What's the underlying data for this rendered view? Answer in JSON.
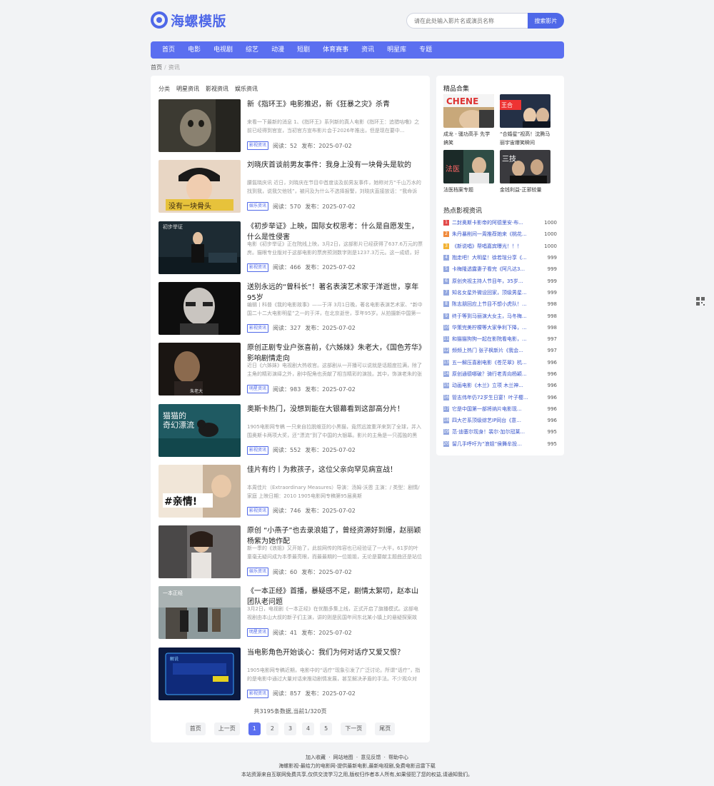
{
  "brand": {
    "name": "海螺模版",
    "accent": "#4f68e8"
  },
  "search": {
    "placeholder": "请在此处输入影片名或演员名称",
    "button": "搜索影片"
  },
  "nav": [
    "首页",
    "电影",
    "电视剧",
    "综艺",
    "动漫",
    "短剧",
    "体育赛事",
    "资讯",
    "明星库",
    "专题"
  ],
  "breadcrumb": {
    "home": "首页",
    "current": "资讯"
  },
  "categories": {
    "label": "分类",
    "items": [
      "明星资讯",
      "影视资讯",
      "娱乐资讯"
    ]
  },
  "articles": [
    {
      "title": "新《指环王》电影推迟，新《狂暴之灾》杀青",
      "desc": "来看一下最新的消息 1、《指环王》系列新的真人电影《指环王：追猎咕噜》之前已经得到官宣，当初官方宣布影片会于2026年推出，但是现在要中...",
      "tag": "影视资讯",
      "reads": "阅读：52",
      "date": "发布：2025-07-02",
      "thumb": "dark-creature"
    },
    {
      "title": "刘晓庆首谈前男友事件：我身上没有一块骨头是软的",
      "desc": "腰氤晓庆讯 近日，刘晓庆在节目中首度谈及前男友事件，她称对方“千山万水的找到我，说我欠他钱”，被问及为什么不选择报警，刘晓庆直接放话：“我命诉",
      "tag": "娱乐资讯",
      "reads": "阅读：570",
      "date": "发布：2025-07-02",
      "thumb": "woman-hat"
    },
    {
      "title": "《初步举证》上映，国际女权思考：什么是自愿发生，什么是性侵害",
      "desc": "电影《初步举证》正在院线上映，3月2日，这部影片已经获得了637.6万元的票房。猫眼专业版对于这部电影的票房预测数字则是1237.3万元。这一成绩，好像",
      "tag": "影视资讯",
      "reads": "阅读：466",
      "date": "发布：2025-07-02",
      "thumb": "stage-woman"
    },
    {
      "title": "送别永远的“曾科长”！著名表演艺术家于洋逝世，享年95岁",
      "desc": "编辑丨科普《我的电影故事》——于洋 3月1日晚，著名电影表演艺术家、“新中国二十二大电影明星”之一的于洋，在北京逝世，享年95岁。从拍摄新中国第一",
      "tag": "影视资讯",
      "reads": "阅读：327",
      "date": "发布：2025-07-02",
      "thumb": "old-man"
    },
    {
      "title": "原创正剧专业户张喜前，《六姊妹》朱老大，《国色芳华》影响剧情走向",
      "desc": "近日《六姊妹》电视剧大热收官。这部剧从一开播可以说就是话题度拉满，除了主角的精彩演绎之外，剧中配角也贡献了相当精彩的演技。其中，饰演老朱的张",
      "tag": "明星资讯",
      "reads": "阅读：983",
      "date": "发布：2025-07-02",
      "thumb": "man-dark"
    },
    {
      "title": "奥斯卡热门，没想到能在大银幕看到这部高分片！",
      "desc": "1905电影网专稿 一只来自拉脱维亚的小黑猫，竟然远渡重洋来到了全球，并入围奥斯卡两项大奖，还“漂流”到了中国的大银幕。影片的主角是一只孤独的黑",
      "tag": "影视资讯",
      "reads": "阅读：552",
      "date": "发布：2025-07-02",
      "thumb": "cat-poster"
    },
    {
      "title": "佳片有约丨为救孩子，这位父亲向罕见病宣战！",
      "desc": "本周佳片（Extraordinary Measures）导演：汤姆·沃恩 主演：/ 类型：剧情/家庭 上映日期：2010 1905电影网专稿第95届奥斯",
      "tag": "影视资讯",
      "reads": "阅读：746",
      "date": "发布：2025-07-02",
      "thumb": "family"
    },
    {
      "title": "原创 “小燕子”也去录浪姐了，曾经资源好到爆，赵丽颖杨紫为她作配",
      "desc": "新一季的《浪姐》又开始了，此前网传的阵容也已经验证了一大半，61岁的叶童毫无疑问成为本季最亮眼，而最最期的一位姐姐，无论是要献主题曲还是站位安",
      "tag": "娱乐资讯",
      "reads": "阅读：60",
      "date": "发布：2025-07-02",
      "thumb": "woman-street"
    },
    {
      "title": "《一本正经》首播，暴疑感不足，剧情太絮叨，赵本山团队老问题",
      "desc": "3月2日，电视剧《一本正经》在优酷多集上线，正式开启了旗播模式。这部电视剧由本山大叔的新子们主演，讲的则是民国年间东北某小镇上的悬疑探案故事。",
      "tag": "明星资讯",
      "reads": "阅读：41",
      "date": "发布：2025-07-02",
      "thumb": "village"
    },
    {
      "title": "当电影角色开始谈心：我们为何对话疗又爱又恨？",
      "desc": "1905电影网专稿近期，电影中的“话疗”现象引发了广泛讨论。所谓“话疗”，指的是电影中通过大量对话来推动剧情发展，甚至解决矛盾的手法。不少观众对",
      "tag": "影视资讯",
      "reads": "阅读：857",
      "date": "发布：2025-07-02",
      "thumb": "blue-screen"
    }
  ],
  "pagination": {
    "info": "共3195条数据,当前1/320页",
    "first": "首页",
    "prev": "上一页",
    "pages": [
      "1",
      "2",
      "3",
      "4",
      "5"
    ],
    "next": "下一页",
    "last": "尾页"
  },
  "collections": {
    "title": "精品合集",
    "items": [
      {
        "name": "成龙 - 骚功高手 先学搞笑",
        "thumb": "jackie"
      },
      {
        "name": "“合婚星”视高！沈腾马丽宇宙爆笑瞬间",
        "thumb": "duo"
      },
      {
        "name": "法医档案专题",
        "thumb": "forensic"
      },
      {
        "name": "金钱利益-正邪较量",
        "thumb": "money"
      }
    ]
  },
  "hot": {
    "title": "热点影视资讯",
    "items": [
      {
        "name": "二封奥斯卡影帝的阿德里安·布...",
        "count": "1000"
      },
      {
        "name": "朱丹暴削间一周推荐她来《桃花...",
        "count": "1000"
      },
      {
        "name": "《新说唱》帮唱嘉宾曝光！！！",
        "count": "1000"
      },
      {
        "name": "抱走吧！大明星！徐若瑄分享《...",
        "count": "999"
      },
      {
        "name": "卡梅隆透露妻子看完《阿凡达3...",
        "count": "999"
      },
      {
        "name": "原创央视主持人节目年，35岁...",
        "count": "999"
      },
      {
        "name": "知名女星外微设回家，顶级男星...",
        "count": "999"
      },
      {
        "name": "陈志朋回应上节目不想小虎队！...",
        "count": "998"
      },
      {
        "name": "终于等到马丽演大女主，马冬梅...",
        "count": "998"
      },
      {
        "name": "华策完美柠檬等大家争利下降，...",
        "count": "998"
      },
      {
        "name": "和猫猫狗狗一起在影院看电影，...",
        "count": "997"
      },
      {
        "name": "频频上热门 张子枫新片《我会...",
        "count": "997"
      },
      {
        "name": "五一解压喜剧电影《苍茫翠》杭...",
        "count": "996"
      },
      {
        "name": "原创通德哪破？骑行老青向杨颖...",
        "count": "996"
      },
      {
        "name": "动画电影《木兰》立项 木兰神...",
        "count": "996"
      },
      {
        "name": "管志伟年仍72岁生日宴！叶子樱...",
        "count": "996"
      },
      {
        "name": "它是中国第一部将纳片电影现...",
        "count": "996"
      },
      {
        "name": "四大芒系顶级综艺IP同台《意...",
        "count": "996"
      },
      {
        "name": "范·迪塞尔现身！裴尔·加尔冠莱...",
        "count": "995"
      },
      {
        "name": "留几手呼吁为“浪姐”侯舞牟投...",
        "count": "995"
      }
    ]
  },
  "footer": {
    "links": [
      "加入收藏",
      "网站地图",
      "意见反馈",
      "帮助中心"
    ],
    "line2": "海螺影视-最给力的电影网-提供最新电影,最新电视剧,免费电影迅雷下载",
    "line3": "本站资源来自互联网免费共享,仅供交流学习之用,版权归作者本人所有,如果侵犯了您的权益,请通知我们。"
  }
}
